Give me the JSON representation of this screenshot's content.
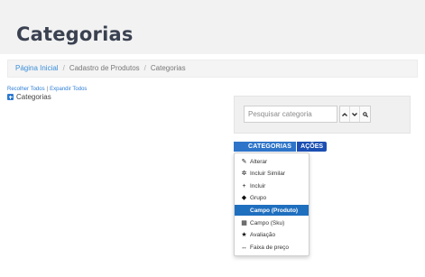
{
  "header": {
    "title": "Categorias"
  },
  "breadcrumb": {
    "items": [
      "Página Inicial",
      "Cadastro de Produtos",
      "Categorias"
    ]
  },
  "tree": {
    "collapse_all": "Recolher Todos",
    "separator": "|",
    "expand_all": "Expandir Todos",
    "root_label": "Categorias"
  },
  "search": {
    "placeholder": "Pesquisar categoria",
    "up_icon": "chevron-up-icon",
    "down_icon": "chevron-down-icon",
    "search_icon": "search-icon"
  },
  "category_bar": {
    "label": "CATEGORIAS",
    "actions_label": "AÇÕES"
  },
  "actions_menu": {
    "items": [
      {
        "label": "Alterar",
        "icon": "pencil-icon"
      },
      {
        "label": "Incluir Similar",
        "icon": "gear-icon"
      },
      {
        "label": "Incluir",
        "icon": "plus-icon"
      },
      {
        "label": "Grupo",
        "icon": "tag-icon"
      },
      {
        "label": "Campo (Produto)",
        "icon": "field-icon"
      },
      {
        "label": "Campo (Sku)",
        "icon": "grid-icon"
      },
      {
        "label": "Avaliação",
        "icon": "star-icon"
      },
      {
        "label": "Faixa de preço",
        "icon": "range-icon"
      }
    ],
    "active_index": 4
  },
  "colors": {
    "accent": "#2e75c9",
    "actions": "#1c4fb3",
    "active_item": "#1f6fbf",
    "link": "#3b8fd9"
  }
}
